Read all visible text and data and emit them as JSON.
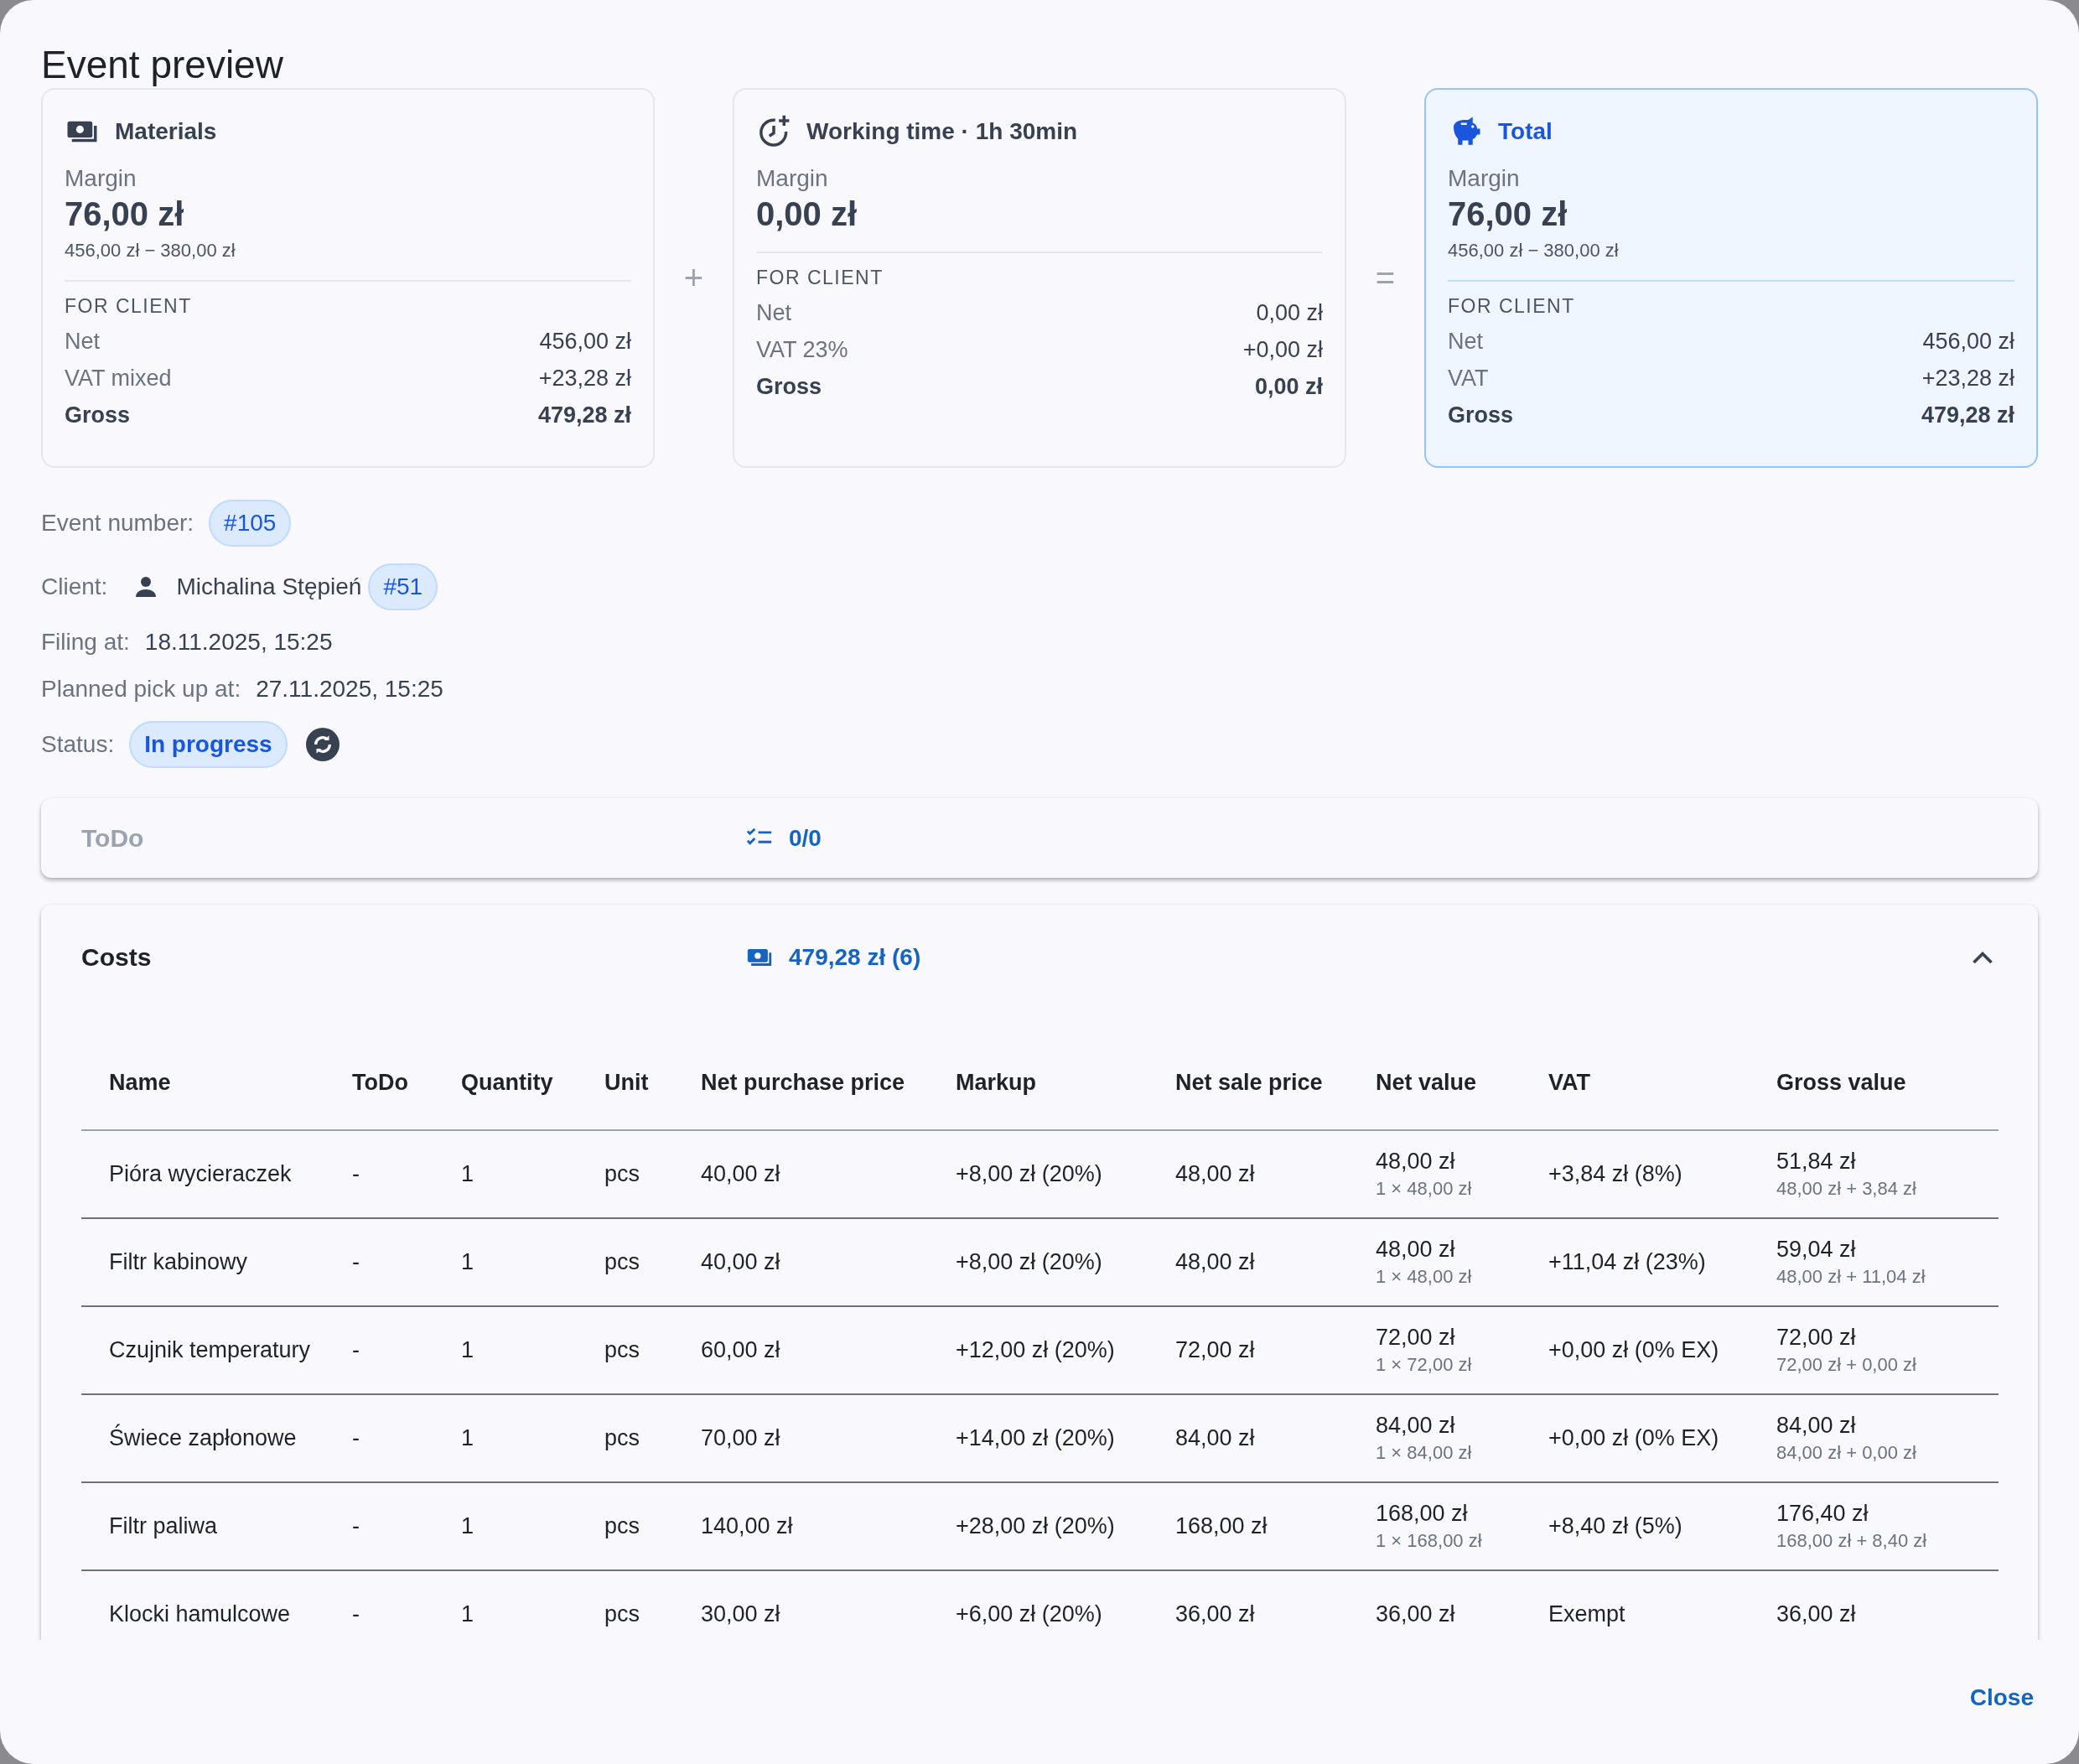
{
  "dialog": {
    "title": "Event preview"
  },
  "summary_cards": [
    {
      "kind": "materials",
      "title": "Materials",
      "highlighted": false,
      "operator_after": "+",
      "margin_label": "Margin",
      "margin": "76,00 zł",
      "margin_formula": "456,00 zł − 380,00 zł",
      "section_label": "FOR CLIENT",
      "rows": [
        {
          "kind": "normal",
          "label": "Net",
          "value": "456,00 zł"
        },
        {
          "kind": "normal",
          "label": "VAT mixed",
          "value": "+23,28 zł"
        },
        {
          "kind": "total",
          "label": "Gross",
          "value": "479,28 zł"
        }
      ]
    },
    {
      "kind": "time",
      "title": "Working time · 1h 30min",
      "highlighted": false,
      "operator_after": "=",
      "margin_label": "Margin",
      "margin": "0,00 zł",
      "section_label": "FOR CLIENT",
      "rows": [
        {
          "kind": "normal",
          "label": "Net",
          "value": "0,00 zł"
        },
        {
          "kind": "normal",
          "label": "VAT 23%",
          "value": "+0,00 zł"
        },
        {
          "kind": "total",
          "label": "Gross",
          "value": "0,00 zł"
        }
      ]
    },
    {
      "kind": "total",
      "title": "Total",
      "highlighted": true,
      "margin_label": "Margin",
      "margin": "76,00 zł",
      "margin_formula": "456,00 zł − 380,00 zł",
      "section_label": "FOR CLIENT",
      "rows": [
        {
          "kind": "normal",
          "label": "Net",
          "value": "456,00 zł"
        },
        {
          "kind": "normal",
          "label": "VAT",
          "value": "+23,28 zł"
        },
        {
          "kind": "total",
          "label": "Gross",
          "value": "479,28 zł"
        }
      ]
    }
  ],
  "details": {
    "event_number": {
      "label": "Event number:",
      "value": "#105"
    },
    "client": {
      "label": "Client:",
      "name": "Michalina Stępień",
      "badge": "#51"
    },
    "filing": {
      "label": "Filing at:",
      "value": "18.11.2025, 15:25"
    },
    "planned_pickup": {
      "label": "Planned pick up at:",
      "value": "27.11.2025, 15:25"
    },
    "status": {
      "label": "Status:",
      "value": "In progress"
    }
  },
  "todo_panel": {
    "title": "ToDo",
    "count": "0/0"
  },
  "costs_panel": {
    "title": "Costs",
    "summary": "479,28 zł (6)",
    "expanded": true,
    "columns": [
      "Name",
      "ToDo",
      "Quantity",
      "Unit",
      "Net purchase price",
      "Markup",
      "Net sale price",
      "Net value",
      "VAT",
      "Gross value"
    ],
    "rows": [
      {
        "name": "Pióra wycieraczek",
        "todo": "-",
        "quantity": "1",
        "unit": "pcs",
        "net_purchase_price": "40,00 zł",
        "markup": "+8,00 zł (20%)",
        "net_sale_price": "48,00 zł",
        "net_value": "48,00 zł",
        "net_value_detail": "1 × 48,00 zł",
        "vat": "+3,84 zł (8%)",
        "gross_value": "51,84 zł",
        "gross_value_detail": "48,00 zł + 3,84 zł"
      },
      {
        "name": "Filtr kabinowy",
        "todo": "-",
        "quantity": "1",
        "unit": "pcs",
        "net_purchase_price": "40,00 zł",
        "markup": "+8,00 zł (20%)",
        "net_sale_price": "48,00 zł",
        "net_value": "48,00 zł",
        "net_value_detail": "1 × 48,00 zł",
        "vat": "+11,04 zł (23%)",
        "gross_value": "59,04 zł",
        "gross_value_detail": "48,00 zł + 11,04 zł"
      },
      {
        "name": "Czujnik temperatury",
        "todo": "-",
        "quantity": "1",
        "unit": "pcs",
        "net_purchase_price": "60,00 zł",
        "markup": "+12,00 zł (20%)",
        "net_sale_price": "72,00 zł",
        "net_value": "72,00 zł",
        "net_value_detail": "1 × 72,00 zł",
        "vat": "+0,00 zł (0% EX)",
        "gross_value": "72,00 zł",
        "gross_value_detail": "72,00 zł + 0,00 zł"
      },
      {
        "name": "Świece zapłonowe",
        "todo": "-",
        "quantity": "1",
        "unit": "pcs",
        "net_purchase_price": "70,00 zł",
        "markup": "+14,00 zł (20%)",
        "net_sale_price": "84,00 zł",
        "net_value": "84,00 zł",
        "net_value_detail": "1 × 84,00 zł",
        "vat": "+0,00 zł (0% EX)",
        "gross_value": "84,00 zł",
        "gross_value_detail": "84,00 zł + 0,00 zł"
      },
      {
        "name": "Filtr paliwa",
        "todo": "-",
        "quantity": "1",
        "unit": "pcs",
        "net_purchase_price": "140,00 zł",
        "markup": "+28,00 zł (20%)",
        "net_sale_price": "168,00 zł",
        "net_value": "168,00 zł",
        "net_value_detail": "1 × 168,00 zł",
        "vat": "+8,40 zł (5%)",
        "gross_value": "176,40 zł",
        "gross_value_detail": "168,00 zł + 8,40 zł"
      },
      {
        "name": "Klocki hamulcowe",
        "todo": "-",
        "quantity": "1",
        "unit": "pcs",
        "net_purchase_price": "30,00 zł",
        "markup": "+6,00 zł (20%)",
        "net_sale_price": "36,00 zł",
        "net_value": "36,00 zł",
        "vat": "Exempt",
        "gross_value": "36,00 zł"
      }
    ]
  },
  "footer": {
    "buttons": [
      "Close"
    ]
  }
}
